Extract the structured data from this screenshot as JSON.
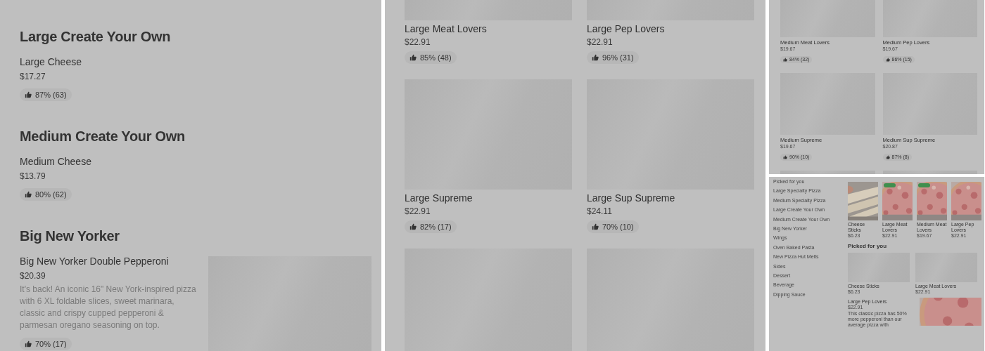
{
  "menu_view": {
    "sections": [
      {
        "title": "Large Create Your Own",
        "items": [
          {
            "name": "Large Cheese",
            "price": "$17.27",
            "rating": "87% (63)"
          }
        ]
      },
      {
        "title": "Medium Create Your Own",
        "items": [
          {
            "name": "Medium Cheese",
            "price": "$13.79",
            "rating": "80% (62)"
          }
        ]
      },
      {
        "title": "Big New Yorker",
        "items": [
          {
            "name": "Big New Yorker Double Pepperoni",
            "price": "$20.39",
            "description": "It's back! An iconic 16\" New York-inspired pizza with 6 XL foldable slices, sweet marinara, classic and crispy cupped pepperoni & parmesan oregano seasoning on top.",
            "rating": "70% (17)",
            "kind": "with_image"
          }
        ]
      }
    ]
  },
  "large_grid_view": {
    "rows": [
      [
        {
          "kind": "card",
          "name": "Large Meat Lovers",
          "price": "$22.91",
          "rating": "85% (48)"
        },
        {
          "kind": "card",
          "name": "Large Pep Lovers",
          "price": "$22.91",
          "rating": "96% (31)"
        }
      ],
      [
        {
          "kind": "card",
          "name": "Large Supreme",
          "price": "$22.91",
          "rating": "82% (17)"
        },
        {
          "kind": "card",
          "name": "Large Sup Supreme",
          "price": "$24.11",
          "rating": "70% (10)"
        }
      ],
      [
        {
          "kind": "placeholder"
        },
        {
          "kind": "placeholder"
        }
      ]
    ]
  },
  "medium_grid_view": {
    "rows": [
      [
        {
          "kind": "card",
          "name": "Medium Meat Lovers",
          "price": "$19.67",
          "rating": "84% (32)"
        },
        {
          "kind": "card",
          "name": "Medium Pep Lovers",
          "price": "$19.67",
          "rating": "86% (15)"
        }
      ],
      [
        {
          "kind": "card",
          "name": "Medium Supreme",
          "price": "$19.67",
          "rating": "90% (10)"
        },
        {
          "kind": "card",
          "name": "Medium Sup Supreme",
          "price": "$20.87",
          "rating": "87% (8)"
        }
      ],
      [
        {
          "kind": "placeholder"
        },
        {
          "kind": "placeholder"
        }
      ]
    ]
  },
  "home_view": {
    "sidebar": {
      "items": [
        "Picked for you",
        "Large Specialty Pizza",
        "Medium Specialty Pizza",
        "Large Create Your Own",
        "Medium Create Your Own",
        "Big New Yorker",
        "Wings",
        "Oven Baked Pasta",
        "New Pizza Hut Melts",
        "Sides",
        "Dessert",
        "Beverage",
        "Dipping Sauce"
      ]
    },
    "featured": [
      {
        "name": "Cheese Sticks",
        "price": "$6.23",
        "tagged": false
      },
      {
        "name": "Large Meat Lovers",
        "price": "$22.91",
        "tagged": true
      },
      {
        "name": "Medium Meat Lovers",
        "price": "$19.67",
        "tagged": true
      },
      {
        "name": "Large Pep Lovers",
        "price": "$22.91",
        "tagged": false
      }
    ],
    "picked_for_you": {
      "title": "Picked for you",
      "cards": [
        {
          "name": "Cheese Sticks",
          "price": "$6.23"
        },
        {
          "name": "Large Meat Lovers",
          "price": "$22.91"
        }
      ],
      "list_item": {
        "name": "Large Pep Lovers",
        "price": "$22.91",
        "description": "This classic pizza has 50% more pepperoni than our average pizza with"
      }
    }
  }
}
